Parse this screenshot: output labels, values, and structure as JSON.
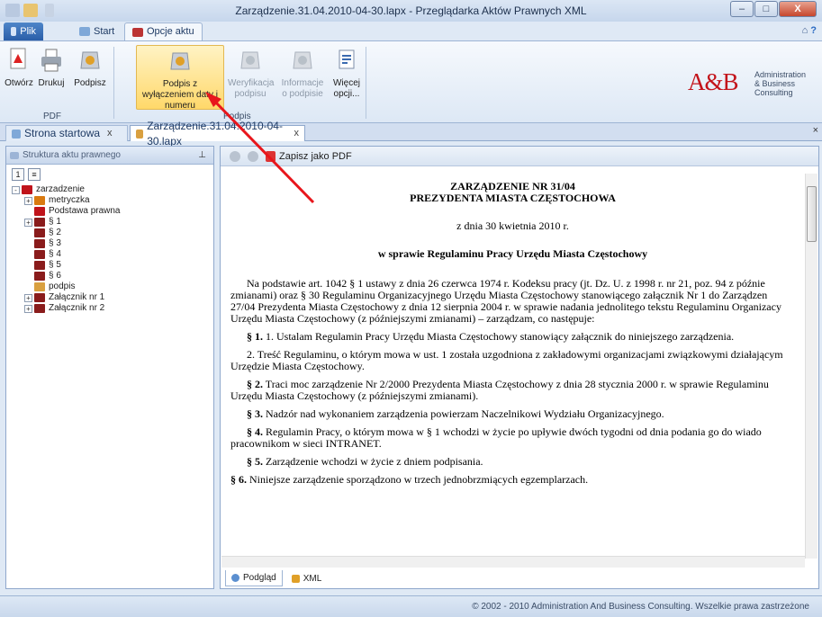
{
  "window": {
    "title": "Zarządzenie.31.04.2010-04-30.lapx - Przeglądarka Aktów Prawnych XML",
    "minimize": "–",
    "maximize": "□",
    "close": "X"
  },
  "ribbon_tabs": [
    {
      "label": "Plik"
    },
    {
      "label": "Start"
    },
    {
      "label": "Opcje aktu"
    }
  ],
  "ribbon": {
    "buttons": [
      {
        "label": "Otwórz",
        "icon": "pdf-open-icon"
      },
      {
        "label": "Drukuj",
        "icon": "printer-icon"
      },
      {
        "label": "Podpisz",
        "icon": "sign-icon"
      },
      {
        "label": "Podpis z wyłączeniem daty i numeru",
        "icon": "sign-icon"
      },
      {
        "label": "Weryfikacja podpisu",
        "icon": "verify-icon"
      },
      {
        "label": "Informacje o podpisie",
        "icon": "info-icon"
      },
      {
        "label": "Więcej opcji...",
        "icon": "more-options-icon"
      }
    ],
    "groups": [
      "PDF",
      "Podpis"
    ]
  },
  "logo": {
    "text": "A&B",
    "subtitle_1": "Administration",
    "subtitle_2": "& Business",
    "subtitle_3": "Consulting"
  },
  "doc_tabs": [
    {
      "label": "Strona startowa",
      "close": "x"
    },
    {
      "label": "Zarządzenie.31.04.2010-04-30.lapx",
      "close": "x"
    }
  ],
  "left_pane": {
    "title": "Struktura aktu prawnego",
    "pin": "⊥",
    "tree": [
      {
        "label": "zarzadzenie",
        "level": 0,
        "expander": "-"
      },
      {
        "label": "metryczka",
        "level": 1,
        "expander": "+"
      },
      {
        "label": "Podstawa prawna",
        "level": 1,
        "expander": ""
      },
      {
        "label": "§ 1",
        "level": 1,
        "expander": "+"
      },
      {
        "label": "§ 2",
        "level": 1,
        "expander": ""
      },
      {
        "label": "§ 3",
        "level": 1,
        "expander": ""
      },
      {
        "label": "§ 4",
        "level": 1,
        "expander": ""
      },
      {
        "label": "§ 5",
        "level": 1,
        "expander": ""
      },
      {
        "label": "§ 6",
        "level": 1,
        "expander": ""
      },
      {
        "label": "podpis",
        "level": 1,
        "expander": ""
      },
      {
        "label": "Załącznik nr 1",
        "level": 1,
        "expander": "+"
      },
      {
        "label": "Załącznik nr 2",
        "level": 1,
        "expander": "+"
      }
    ]
  },
  "main_pane": {
    "save_pdf": "Zapisz jako PDF",
    "bottom_tabs": [
      {
        "label": "Podgląd"
      },
      {
        "label": "XML"
      }
    ]
  },
  "document": {
    "title_1": "ZARZĄDZENIE NR 31/04",
    "title_2": "PREZYDENTA MIASTA CZĘSTOCHOWA",
    "date": "z dnia 30 kwietnia 2010 r.",
    "subject": "w sprawie Regulaminu Pracy Urzędu Miasta Częstochowy",
    "preamble_1": "Na podstawie art. 1042 § 1 ustawy z dnia 26 czerwca 1974 r. Kodeksu pracy (jt. Dz. U. z 1998 r. nr 21, poz. 94 z późnie",
    "preamble_2": "zmianami) oraz § 30 Regulaminu Organizacyjnego Urzędu Miasta Częstochowy stanowiącego załącznik Nr 1 do Zarządzen",
    "preamble_3": "27/04 Prezydenta Miasta Częstochowy z dnia 12 sierpnia 2004 r. w sprawie nadania jednolitego tekstu Regulaminu Organizacy",
    "preamble_4": "Urzędu Miasta Częstochowy (z późniejszymi zmianami) – zarządzam, co następuje:",
    "p1_mark": "§ 1.",
    "p1_1": "1. Ustalam Regulamin Pracy Urzędu Miasta Częstochowy stanowiący załącznik do niniejszego zarządzenia.",
    "p1_2a": "2. Treść Regulaminu, o którym mowa w ust. 1 została uzgodniona z zakładowymi organizacjami związkowymi działającym",
    "p1_2b": "Urzędzie Miasta Częstochowy.",
    "p2_mark": "§ 2.",
    "p2a": "Traci moc zarządzenie Nr 2/2000 Prezydenta Miasta Częstochowy z dnia 28 stycznia 2000 r. w sprawie Regulaminu",
    "p2b": "Urzędu Miasta Częstochowy (z późniejszymi zmianami).",
    "p3_mark": "§ 3.",
    "p3": "Nadzór nad wykonaniem zarządzenia powierzam Naczelnikowi Wydziału Organizacyjnego.",
    "p4_mark": "§ 4.",
    "p4a": "Regulamin Pracy, o którym mowa w § 1 wchodzi w życie po upływie dwóch tygodni od dnia podania go do wiado",
    "p4b": "pracownikom w sieci INTRANET.",
    "p5_mark": "§ 5.",
    "p5": "Zarządzenie wchodzi w życie z dniem podpisania.",
    "p6_mark": "§ 6.",
    "p6": "Niniejsze zarządzenie sporządzono w trzech jednobrzmiących egzemplarzach."
  },
  "status": {
    "text": "© 2002 - 2010 Administration And Business Consulting. Wszelkie prawa zastrzeżone"
  },
  "colors": {
    "accent": "#c3141b",
    "ribbon_highlight": "#ffd86a",
    "arrow": "#e8161c"
  }
}
